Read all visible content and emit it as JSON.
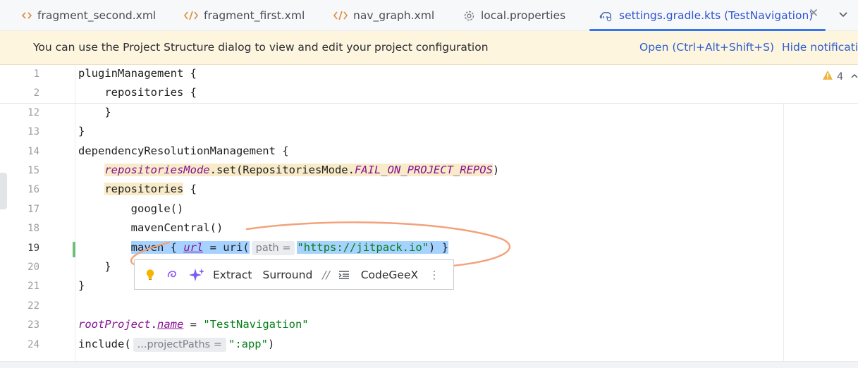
{
  "tabs": [
    {
      "label": "fragment_second.xml",
      "icon": "xml-file-icon",
      "active": false
    },
    {
      "label": "fragment_first.xml",
      "icon": "xml-file-icon",
      "active": false
    },
    {
      "label": "nav_graph.xml",
      "icon": "xml-file-icon",
      "active": false
    },
    {
      "label": "local.properties",
      "icon": "gear-icon",
      "active": false
    },
    {
      "label": "settings.gradle.kts (TestNavigation)",
      "icon": "gradle-elephant-icon",
      "active": true
    }
  ],
  "tab_bar": {
    "close_symbol": "✕",
    "more_icon": "chevron-down-icon"
  },
  "banner": {
    "message": "You can use the Project Structure dialog to view and edit your project configuration",
    "open_link": "Open (Ctrl+Alt+Shift+S)",
    "hide_link": "Hide notification"
  },
  "warnings": {
    "count": "4"
  },
  "editor": {
    "lines": [
      {
        "num": "1",
        "tokens": [
          {
            "t": "pluginManagement {"
          }
        ]
      },
      {
        "num": "2",
        "tokens": [
          {
            "t": "    repositories {"
          }
        ]
      },
      {
        "num": "12",
        "tokens": [
          {
            "t": "    }"
          }
        ]
      },
      {
        "num": "13",
        "tokens": [
          {
            "t": "}"
          }
        ]
      },
      {
        "num": "14",
        "tokens": [
          {
            "t": "dependencyResolutionManagement {"
          }
        ]
      },
      {
        "num": "15",
        "tokens": [
          {
            "t": "    "
          },
          {
            "t": "repositoriesMode",
            "c": "it-purple hl"
          },
          {
            "t": ".set(RepositoriesMode.",
            "c": "hl"
          },
          {
            "t": "FAIL_ON_PROJECT_REPOS",
            "c": "it-purple hl"
          },
          {
            "t": ")"
          }
        ]
      },
      {
        "num": "16",
        "tokens": [
          {
            "t": "    "
          },
          {
            "t": "repositories",
            "c": "hl"
          },
          {
            "t": " {"
          }
        ]
      },
      {
        "num": "17",
        "tokens": [
          {
            "t": "        google()"
          }
        ]
      },
      {
        "num": "18",
        "tokens": [
          {
            "t": "        mavenCentral()"
          }
        ]
      },
      {
        "num": "19",
        "current": true,
        "tokens": [
          {
            "t": "        "
          },
          {
            "t": "maven { ",
            "c": "sel"
          },
          {
            "t": "url",
            "c": "sel underl"
          },
          {
            "t": " = uri(",
            "c": "sel"
          },
          {
            "hint": "path ="
          },
          {
            "t": "\"https://jitpack.io\"",
            "c": "sel str"
          },
          {
            "t": ") }",
            "c": "sel"
          }
        ]
      },
      {
        "num": "20",
        "tokens": [
          {
            "t": "    }"
          }
        ]
      },
      {
        "num": "21",
        "tokens": [
          {
            "t": "}"
          }
        ]
      },
      {
        "num": "22",
        "tokens": [
          {
            "t": ""
          }
        ]
      },
      {
        "num": "23",
        "tokens": [
          {
            "t": "rootProject",
            "c": "it-purple"
          },
          {
            "t": "."
          },
          {
            "t": "name",
            "c": "underl"
          },
          {
            "t": " = "
          },
          {
            "t": "\"TestNavigation\"",
            "c": "str"
          }
        ]
      },
      {
        "num": "24",
        "tokens": [
          {
            "t": "include("
          },
          {
            "hint": "...projectPaths ="
          },
          {
            "t": "\":app\"",
            "c": "str"
          },
          {
            "t": ")"
          }
        ]
      }
    ]
  },
  "popup": {
    "extract": "Extract",
    "surround": "Surround",
    "comment_glyph": "//",
    "codegeex": "CodeGeeX",
    "more": "⋮"
  },
  "annotation": {
    "color": "#f2a27a"
  },
  "colors": {
    "accent": "#3574f0",
    "banner_bg": "#fdf5de",
    "selection": "#a6d2ff"
  }
}
